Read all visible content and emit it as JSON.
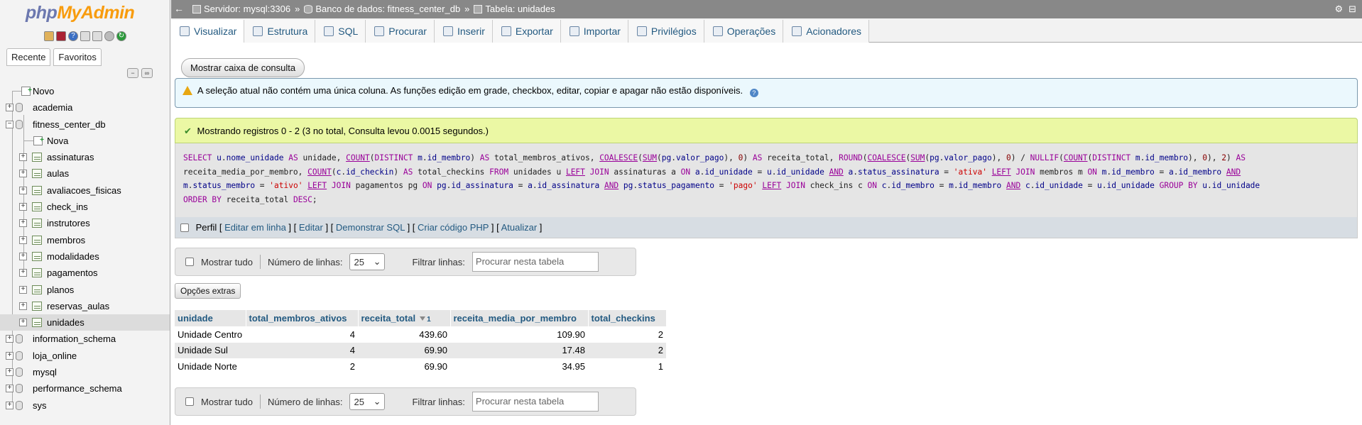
{
  "app": {
    "logo_part1": "php",
    "logo_part2": "MyAdmin"
  },
  "nav": {
    "tabs": [
      "Recente",
      "Favoritos"
    ],
    "tree": [
      {
        "label": "Novo",
        "type": "new",
        "level": 0
      },
      {
        "label": "academia",
        "type": "db",
        "level": 0
      },
      {
        "label": "fitness_center_db",
        "type": "db-open",
        "level": 0
      },
      {
        "label": "Nova",
        "type": "new",
        "level": 1
      },
      {
        "label": "assinaturas",
        "type": "table",
        "level": 1
      },
      {
        "label": "aulas",
        "type": "table",
        "level": 1
      },
      {
        "label": "avaliacoes_fisicas",
        "type": "table",
        "level": 1
      },
      {
        "label": "check_ins",
        "type": "table",
        "level": 1
      },
      {
        "label": "instrutores",
        "type": "table",
        "level": 1
      },
      {
        "label": "membros",
        "type": "table",
        "level": 1
      },
      {
        "label": "modalidades",
        "type": "table",
        "level": 1
      },
      {
        "label": "pagamentos",
        "type": "table",
        "level": 1
      },
      {
        "label": "planos",
        "type": "table",
        "level": 1
      },
      {
        "label": "reservas_aulas",
        "type": "table",
        "level": 1
      },
      {
        "label": "unidades",
        "type": "table",
        "level": 1,
        "selected": true
      },
      {
        "label": "information_schema",
        "type": "db",
        "level": 0
      },
      {
        "label": "loja_online",
        "type": "db",
        "level": 0
      },
      {
        "label": "mysql",
        "type": "db",
        "level": 0
      },
      {
        "label": "performance_schema",
        "type": "db",
        "level": 0
      },
      {
        "label": "sys",
        "type": "db",
        "level": 0
      }
    ]
  },
  "breadcrumb": {
    "server": "Servidor: mysql:3306",
    "database": "Banco de dados: fitness_center_db",
    "table": "Tabela: unidades",
    "separator": "»"
  },
  "menu": {
    "tabs": [
      "Visualizar",
      "Estrutura",
      "SQL",
      "Procurar",
      "Inserir",
      "Exportar",
      "Importar",
      "Privilégios",
      "Operações",
      "Acionadores"
    ]
  },
  "main": {
    "query_box_button": "Mostrar caixa de consulta",
    "notice": "A seleção atual não contém uma única coluna. As funções edição em grade, checkbox, editar, copiar e apagar não estão disponíveis.",
    "success": "Mostrando registros 0 - 2 (3 no total, Consulta levou 0.0015 segundos.)",
    "sql_links": {
      "profile": "Perfil",
      "edit_inline": "Editar em linha",
      "edit": "Editar",
      "explain": "Demonstrar SQL",
      "php_code": "Criar código PHP",
      "refresh": "Atualizar"
    },
    "navbar": {
      "show_all": "Mostrar tudo",
      "rows_label": "Número de linhas:",
      "rows_value": "25",
      "filter_label": "Filtrar linhas:",
      "filter_placeholder": "Procurar nesta tabela"
    },
    "extra_options": "Opções extras"
  },
  "results": {
    "columns": [
      "unidade",
      "total_membros_ativos",
      "receita_total",
      "receita_media_por_membro",
      "total_checkins"
    ],
    "sort_index": "1",
    "rows": [
      [
        "Unidade Centro",
        "4",
        "439.60",
        "109.90",
        "2"
      ],
      [
        "Unidade Sul",
        "4",
        "69.90",
        "17.48",
        "2"
      ],
      [
        "Unidade Norte",
        "2",
        "69.90",
        "34.95",
        "1"
      ]
    ]
  }
}
